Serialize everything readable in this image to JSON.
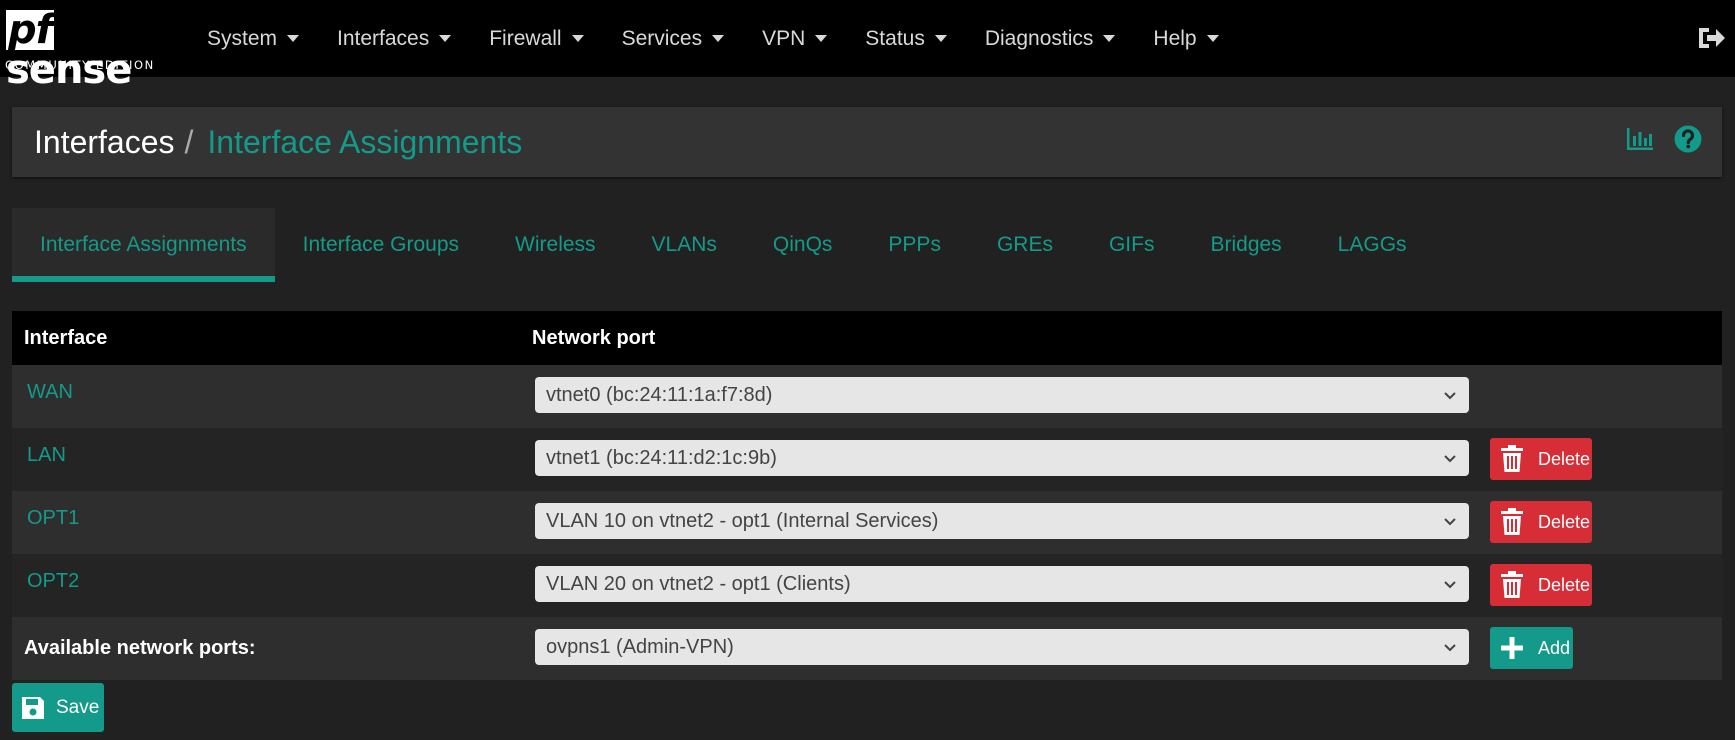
{
  "brand": {
    "logo": "pfsense",
    "edition": "COMMUNITY EDITION"
  },
  "nav": {
    "items": [
      {
        "label": "System"
      },
      {
        "label": "Interfaces"
      },
      {
        "label": "Firewall"
      },
      {
        "label": "Services"
      },
      {
        "label": "VPN"
      },
      {
        "label": "Status"
      },
      {
        "label": "Diagnostics"
      },
      {
        "label": "Help"
      }
    ],
    "logout_icon": "sign-out-icon"
  },
  "header": {
    "breadcrumb_root": "Interfaces",
    "breadcrumb_sep": "/",
    "breadcrumb_current": "Interface Assignments",
    "icons": [
      "bar-chart-icon",
      "help-icon"
    ]
  },
  "tabs": [
    {
      "label": "Interface Assignments",
      "active": true
    },
    {
      "label": "Interface Groups"
    },
    {
      "label": "Wireless"
    },
    {
      "label": "VLANs"
    },
    {
      "label": "QinQs"
    },
    {
      "label": "PPPs"
    },
    {
      "label": "GREs"
    },
    {
      "label": "GIFs"
    },
    {
      "label": "Bridges"
    },
    {
      "label": "LAGGs"
    }
  ],
  "table": {
    "col_interface": "Interface",
    "col_port": "Network port",
    "rows": [
      {
        "iface": "WAN",
        "port": "vtnet0 (bc:24:11:1a:f7:8d)",
        "deletable": false
      },
      {
        "iface": "LAN",
        "port": "vtnet1 (bc:24:11:d2:1c:9b)",
        "deletable": true
      },
      {
        "iface": "OPT1",
        "port": "VLAN 10 on vtnet2 - opt1 (Internal Services)",
        "deletable": true
      },
      {
        "iface": "OPT2",
        "port": "VLAN 20 on vtnet2 - opt1 (Clients)",
        "deletable": true
      }
    ],
    "delete_label": "Delete",
    "available_label": "Available network ports:",
    "available_port": "ovpns1 (Admin-VPN)",
    "add_label": "Add"
  },
  "save_label": "Save",
  "colors": {
    "accent": "#139a8a",
    "danger": "#d62d36",
    "navbar": "#000000",
    "page": "#212121"
  }
}
